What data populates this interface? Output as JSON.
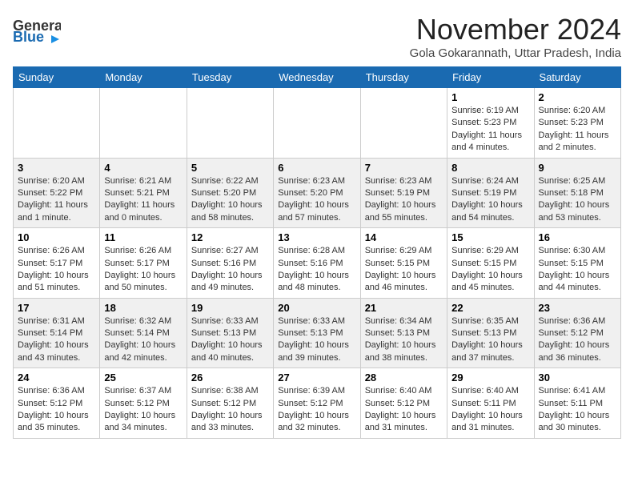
{
  "header": {
    "logo_line1": "General",
    "logo_line2": "Blue",
    "month_title": "November 2024",
    "subtitle": "Gola Gokarannath, Uttar Pradesh, India"
  },
  "days_of_week": [
    "Sunday",
    "Monday",
    "Tuesday",
    "Wednesday",
    "Thursday",
    "Friday",
    "Saturday"
  ],
  "weeks": [
    [
      {
        "day": "",
        "info": ""
      },
      {
        "day": "",
        "info": ""
      },
      {
        "day": "",
        "info": ""
      },
      {
        "day": "",
        "info": ""
      },
      {
        "day": "",
        "info": ""
      },
      {
        "day": "1",
        "info": "Sunrise: 6:19 AM\nSunset: 5:23 PM\nDaylight: 11 hours and 4 minutes."
      },
      {
        "day": "2",
        "info": "Sunrise: 6:20 AM\nSunset: 5:23 PM\nDaylight: 11 hours and 2 minutes."
      }
    ],
    [
      {
        "day": "3",
        "info": "Sunrise: 6:20 AM\nSunset: 5:22 PM\nDaylight: 11 hours and 1 minute."
      },
      {
        "day": "4",
        "info": "Sunrise: 6:21 AM\nSunset: 5:21 PM\nDaylight: 11 hours and 0 minutes."
      },
      {
        "day": "5",
        "info": "Sunrise: 6:22 AM\nSunset: 5:20 PM\nDaylight: 10 hours and 58 minutes."
      },
      {
        "day": "6",
        "info": "Sunrise: 6:23 AM\nSunset: 5:20 PM\nDaylight: 10 hours and 57 minutes."
      },
      {
        "day": "7",
        "info": "Sunrise: 6:23 AM\nSunset: 5:19 PM\nDaylight: 10 hours and 55 minutes."
      },
      {
        "day": "8",
        "info": "Sunrise: 6:24 AM\nSunset: 5:19 PM\nDaylight: 10 hours and 54 minutes."
      },
      {
        "day": "9",
        "info": "Sunrise: 6:25 AM\nSunset: 5:18 PM\nDaylight: 10 hours and 53 minutes."
      }
    ],
    [
      {
        "day": "10",
        "info": "Sunrise: 6:26 AM\nSunset: 5:17 PM\nDaylight: 10 hours and 51 minutes."
      },
      {
        "day": "11",
        "info": "Sunrise: 6:26 AM\nSunset: 5:17 PM\nDaylight: 10 hours and 50 minutes."
      },
      {
        "day": "12",
        "info": "Sunrise: 6:27 AM\nSunset: 5:16 PM\nDaylight: 10 hours and 49 minutes."
      },
      {
        "day": "13",
        "info": "Sunrise: 6:28 AM\nSunset: 5:16 PM\nDaylight: 10 hours and 48 minutes."
      },
      {
        "day": "14",
        "info": "Sunrise: 6:29 AM\nSunset: 5:15 PM\nDaylight: 10 hours and 46 minutes."
      },
      {
        "day": "15",
        "info": "Sunrise: 6:29 AM\nSunset: 5:15 PM\nDaylight: 10 hours and 45 minutes."
      },
      {
        "day": "16",
        "info": "Sunrise: 6:30 AM\nSunset: 5:15 PM\nDaylight: 10 hours and 44 minutes."
      }
    ],
    [
      {
        "day": "17",
        "info": "Sunrise: 6:31 AM\nSunset: 5:14 PM\nDaylight: 10 hours and 43 minutes."
      },
      {
        "day": "18",
        "info": "Sunrise: 6:32 AM\nSunset: 5:14 PM\nDaylight: 10 hours and 42 minutes."
      },
      {
        "day": "19",
        "info": "Sunrise: 6:33 AM\nSunset: 5:13 PM\nDaylight: 10 hours and 40 minutes."
      },
      {
        "day": "20",
        "info": "Sunrise: 6:33 AM\nSunset: 5:13 PM\nDaylight: 10 hours and 39 minutes."
      },
      {
        "day": "21",
        "info": "Sunrise: 6:34 AM\nSunset: 5:13 PM\nDaylight: 10 hours and 38 minutes."
      },
      {
        "day": "22",
        "info": "Sunrise: 6:35 AM\nSunset: 5:13 PM\nDaylight: 10 hours and 37 minutes."
      },
      {
        "day": "23",
        "info": "Sunrise: 6:36 AM\nSunset: 5:12 PM\nDaylight: 10 hours and 36 minutes."
      }
    ],
    [
      {
        "day": "24",
        "info": "Sunrise: 6:36 AM\nSunset: 5:12 PM\nDaylight: 10 hours and 35 minutes."
      },
      {
        "day": "25",
        "info": "Sunrise: 6:37 AM\nSunset: 5:12 PM\nDaylight: 10 hours and 34 minutes."
      },
      {
        "day": "26",
        "info": "Sunrise: 6:38 AM\nSunset: 5:12 PM\nDaylight: 10 hours and 33 minutes."
      },
      {
        "day": "27",
        "info": "Sunrise: 6:39 AM\nSunset: 5:12 PM\nDaylight: 10 hours and 32 minutes."
      },
      {
        "day": "28",
        "info": "Sunrise: 6:40 AM\nSunset: 5:12 PM\nDaylight: 10 hours and 31 minutes."
      },
      {
        "day": "29",
        "info": "Sunrise: 6:40 AM\nSunset: 5:11 PM\nDaylight: 10 hours and 31 minutes."
      },
      {
        "day": "30",
        "info": "Sunrise: 6:41 AM\nSunset: 5:11 PM\nDaylight: 10 hours and 30 minutes."
      }
    ]
  ]
}
